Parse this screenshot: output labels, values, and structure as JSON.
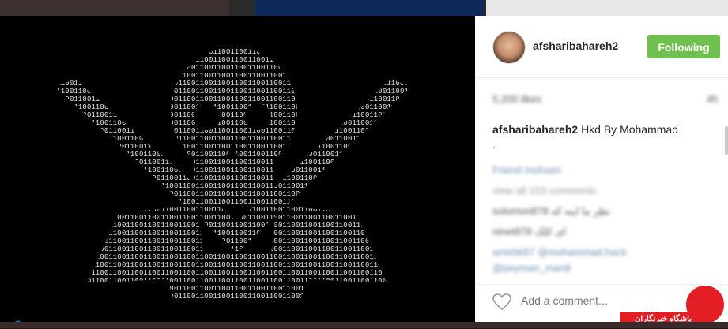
{
  "post": {
    "username": "afsharibahareh2",
    "follow_label": "Following",
    "likes_text": "5,200 likes",
    "time_ago": "4h",
    "caption_user": "afsharibahareh2",
    "caption_text": "Hkd By Mohammad",
    "caption_line2": ".",
    "comment_placeholder": "Add a comment..."
  },
  "comments": [
    {
      "line": "Friend  mohsen"
    },
    {
      "line": "view all 153 comments"
    },
    {
      "line": "solomon878  نظر ما اینه که"
    },
    {
      "line": "ninet878  ای کلک"
    },
    {
      "line": "amirbk87  @mohammad.hack"
    },
    {
      "line": "@peyman_mardi"
    }
  ],
  "watermark": {
    "text": "باشگاه خبرنگاران"
  },
  "colors": {
    "follow_green": "#70c050",
    "watermark_red": "#e31e24",
    "photo_bg": "#000000"
  }
}
